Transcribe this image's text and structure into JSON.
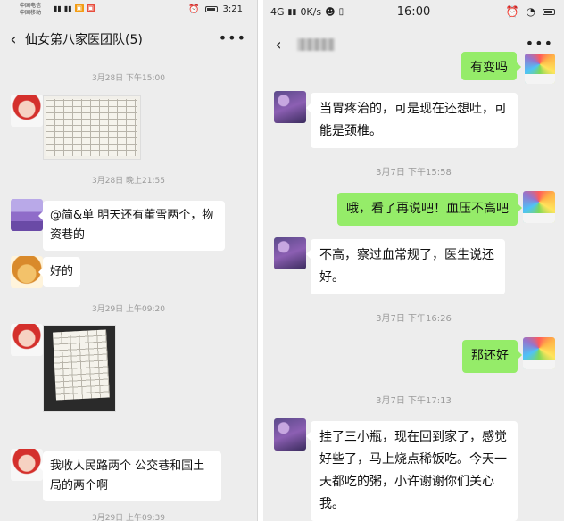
{
  "left": {
    "status": {
      "carrier1": "中国电信",
      "carrier2": "中国移动",
      "time": "3:21"
    },
    "header": {
      "back_icon": "‹",
      "title": "仙女第八家医团队(5)",
      "more_icon": "•••"
    },
    "timestamps": [
      "3月28日 下午15:00",
      "3月28日 晚上21:55",
      "3月29日 上午09:20",
      "3月29日 上午09:39"
    ],
    "messages": [
      {
        "text": "@简&单  明天还有董雪两个，物资巷的"
      },
      {
        "text": "好的"
      },
      {
        "text": "我收人民路两个 公交巷和国土局的两个啊"
      }
    ]
  },
  "right": {
    "status": {
      "network": "4G",
      "speed": "0K/s",
      "time": "16:00"
    },
    "header": {
      "back_icon": "‹",
      "more_icon": "•••"
    },
    "timestamps": [
      "3月7日 下午15:58",
      "3月7日 下午16:26",
      "3月7日 下午17:13"
    ],
    "messages": [
      {
        "text": "有变吗"
      },
      {
        "text": "当胃疼治的，可是现在还想吐，可能是颈椎。"
      },
      {
        "text": "哦，看了再说吧！血压不高吧"
      },
      {
        "text": "不高，察过血常规了，医生说还好。"
      },
      {
        "text": "那还好"
      },
      {
        "text": "挂了三小瓶，现在回到家了，感觉好些了，马上烧点稀饭吃。今天一天都吃的粥，小许谢谢你们关心我。"
      }
    ]
  }
}
